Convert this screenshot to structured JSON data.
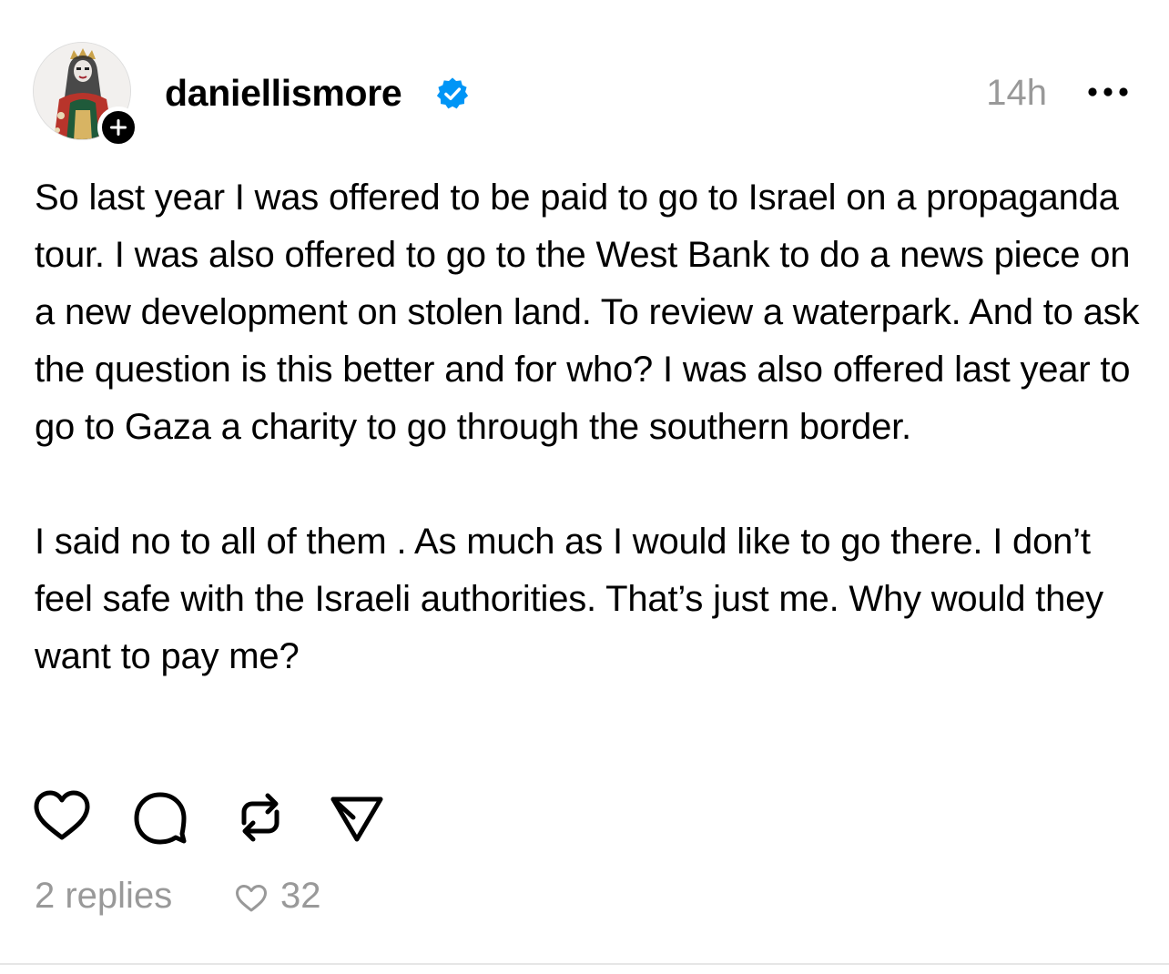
{
  "post": {
    "author": {
      "username": "daniellismore",
      "verified": true,
      "avatar_icon": "profile-avatar",
      "follow_icon": "plus-icon"
    },
    "timestamp": "14h",
    "more_icon": "ellipsis-icon",
    "paragraphs": [
      "So last year I was offered to be paid to go to Israel on a propaganda tour. I was also offered to go to the West Bank to do a news piece on a new development on stolen land. To review a waterpark. And to ask the question is this better and for who? I was also offered last year to go to Gaza a charity to go through the southern border.",
      "I said no to all of them . As much as I would like to go there. I don’t feel safe with the Israeli authorities. That’s just me. Why would they want to pay me?"
    ],
    "actions": [
      "heart-icon",
      "comment-icon",
      "repost-icon",
      "share-icon"
    ],
    "stats": {
      "replies": "2 replies",
      "likes": "32"
    }
  },
  "colors": {
    "text": "#000000",
    "muted": "#999999",
    "verified": "#0095f6",
    "divider": "#e6e6e6"
  }
}
